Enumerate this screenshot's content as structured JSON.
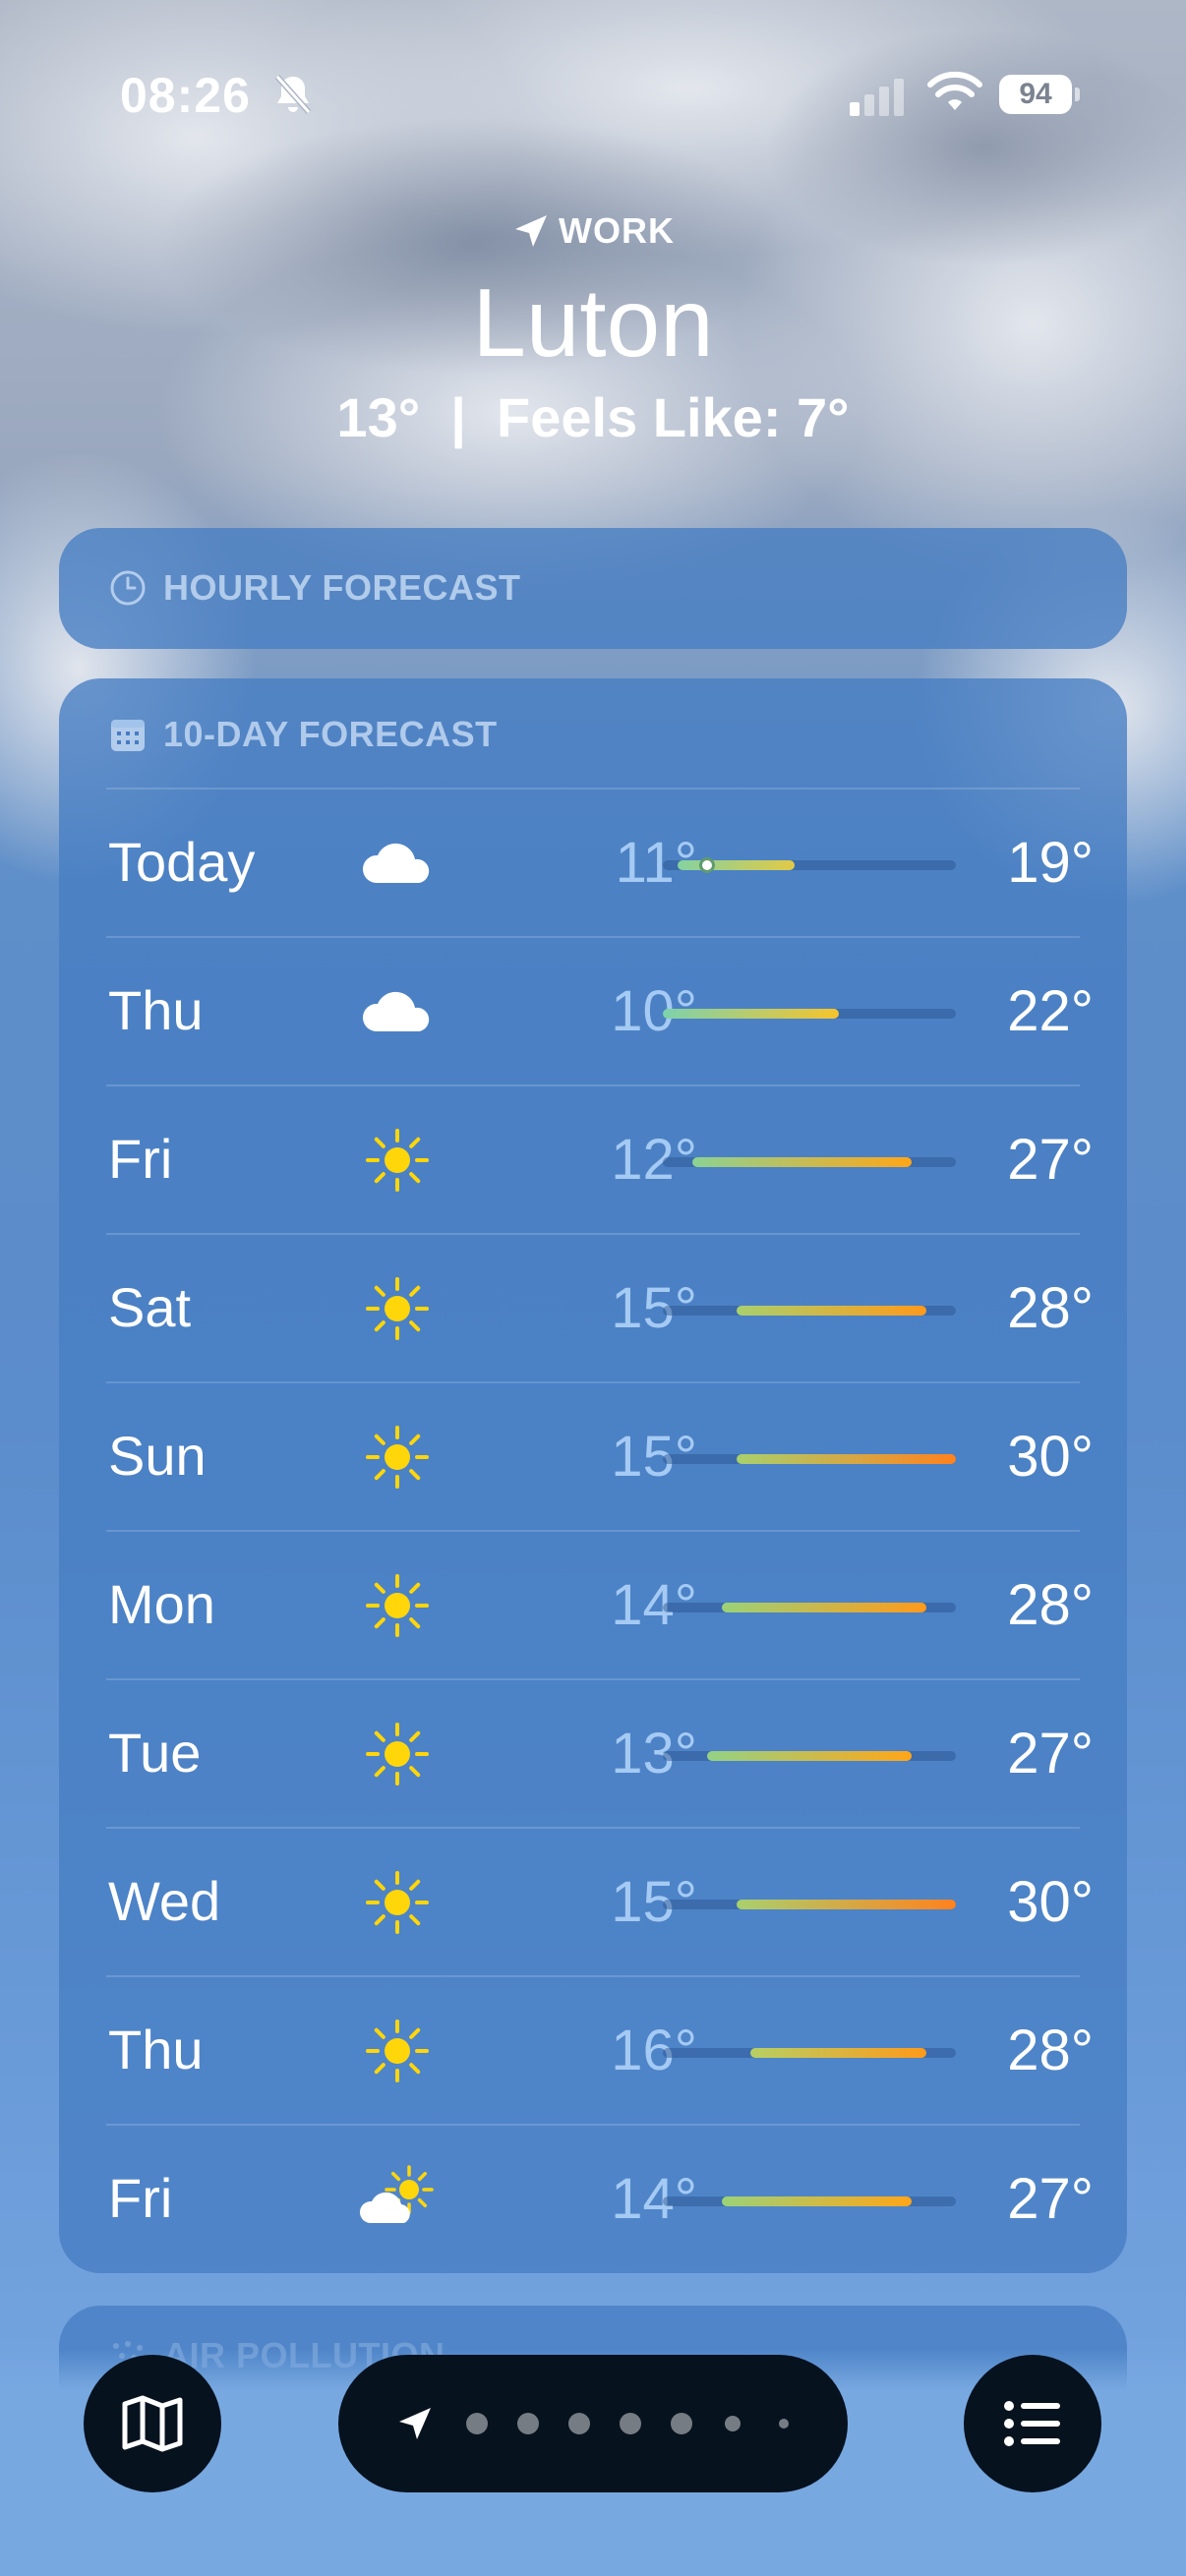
{
  "status_bar": {
    "time": "08:26",
    "battery": "94",
    "icons": [
      "bell-slash-icon",
      "cellular-signal-icon",
      "wifi-icon",
      "battery-icon"
    ]
  },
  "header": {
    "location_label": "WORK",
    "city": "Luton",
    "current": "13°  |  Feels Like: 7°",
    "icon": "location-arrow-icon"
  },
  "hourly": {
    "title": "HOURLY FORECAST",
    "icon": "clock-icon"
  },
  "forecast": {
    "title": "10-DAY FORECAST",
    "icon": "calendar-icon",
    "range": [
      10,
      30
    ],
    "days": [
      {
        "day": "Today",
        "icon": "cloud-icon",
        "low": "11°",
        "high": "19°",
        "low_val": 11,
        "high_val": 19,
        "current_val": 13
      },
      {
        "day": "Thu",
        "icon": "cloud-icon",
        "low": "10°",
        "high": "22°",
        "low_val": 10,
        "high_val": 22
      },
      {
        "day": "Fri",
        "icon": "sun-icon",
        "low": "12°",
        "high": "27°",
        "low_val": 12,
        "high_val": 27
      },
      {
        "day": "Sat",
        "icon": "sun-icon",
        "low": "15°",
        "high": "28°",
        "low_val": 15,
        "high_val": 28
      },
      {
        "day": "Sun",
        "icon": "sun-icon",
        "low": "15°",
        "high": "30°",
        "low_val": 15,
        "high_val": 30
      },
      {
        "day": "Mon",
        "icon": "sun-icon",
        "low": "14°",
        "high": "28°",
        "low_val": 14,
        "high_val": 28
      },
      {
        "day": "Tue",
        "icon": "sun-icon",
        "low": "13°",
        "high": "27°",
        "low_val": 13,
        "high_val": 27
      },
      {
        "day": "Wed",
        "icon": "sun-icon",
        "low": "15°",
        "high": "30°",
        "low_val": 15,
        "high_val": 30
      },
      {
        "day": "Thu",
        "icon": "sun-icon",
        "low": "16°",
        "high": "28°",
        "low_val": 16,
        "high_val": 28
      },
      {
        "day": "Fri",
        "icon": "partly-sunny-icon",
        "low": "14°",
        "high": "27°",
        "low_val": 14,
        "high_val": 27
      }
    ]
  },
  "next_card": {
    "title": "AIR POLLUTION",
    "icon": "air-pollution-icon"
  },
  "bottom_bar": {
    "left_icon": "map-icon",
    "right_icon": "list-icon",
    "page_dots": 7,
    "current_icon": "location-arrow-icon"
  },
  "colors": {
    "sun": "#ffd60a",
    "card": "#467dc3",
    "pill": "#07121f"
  }
}
